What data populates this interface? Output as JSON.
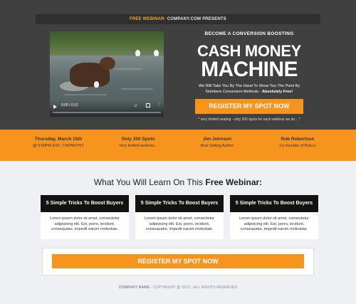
{
  "topbar": {
    "highlight": "FREE WEBINAR:",
    "text": " COMPANY.COM PRESENTS"
  },
  "video": {
    "time": "0:00 / 0:12",
    "progress": 0.0
  },
  "hero": {
    "subtitle": "BECOME A CONVERSION BOOSTING",
    "title_line1": "CASH MONEY",
    "title_line2": "MACHINE",
    "description": "We Will Take You By The Hand To Show You The Point By Numbers Conversion Methods - ",
    "description_emphasis": "Absolutely Free!",
    "cta_label": "REGISTER MY SPOT NOW",
    "note": "* very limited seating - only 200 spots for each webinar we do... *"
  },
  "info": [
    {
      "title": "Thursday, March 15th",
      "sub": "@ 5:00PM EST, 7:00PM PST"
    },
    {
      "title": "Only 200 Spots",
      "sub": "Very limited webinar..."
    },
    {
      "title": "Jim Johnson",
      "sub": "Best Selling Author"
    },
    {
      "title": "Rob Robertson",
      "sub": "Co-founder of Rob.io"
    }
  ],
  "learn": {
    "prefix": "What You Will Learn On This ",
    "bold": "Free Webinar:"
  },
  "cards": [
    {
      "title": "5 Simple Tricks To Boost Buyers",
      "body": "Lorem ipsum dolor sit amet, consectetur adipisicing elit. Est, porro, incidunt, consequatur, impedit earum molestiae."
    },
    {
      "title": "5 Simple Tricks To Boost Buyers",
      "body": "Lorem ipsum dolor sit amet, consectetur adipisicing elit. Est, porro, incidunt, consequatur, impedit earum molestiae."
    },
    {
      "title": "5 Simple Tricks To Boost Buyers",
      "body": "Lorem ipsum dolor sit amet, consectetur adipisicing elit. Est, porro, incidunt, consequatur, impedit earum molestiae."
    }
  ],
  "bottom_cta": {
    "label": "REGISTER MY SPOT NOW"
  },
  "footer": {
    "company": "COMPANY NAME",
    "rest": " - COPYRIGHT @ 2022 - ALL RIGHTS RESERVED"
  },
  "colors": {
    "accent": "#f7941d",
    "hero_bg": "#404040",
    "card_head": "#121212",
    "highlight": "#f7a71c"
  }
}
